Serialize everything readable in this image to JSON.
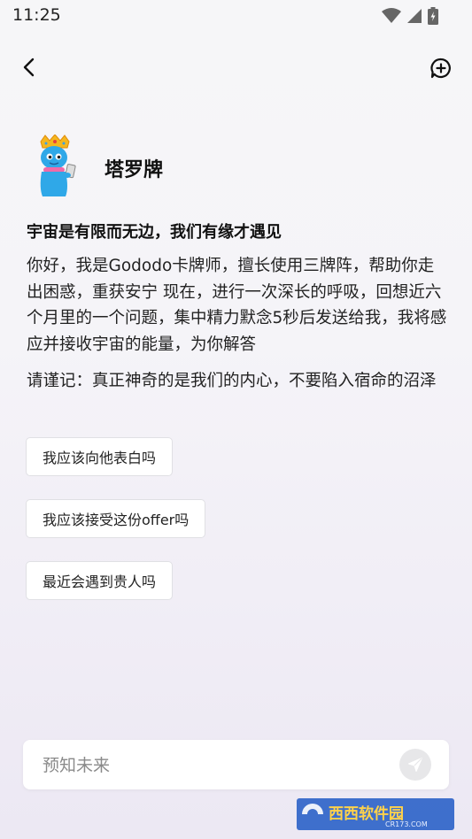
{
  "status_bar": {
    "time": "11:25",
    "icons": [
      "wifi-icon",
      "signal-icon",
      "battery-icon"
    ]
  },
  "nav": {
    "back_icon": "back-arrow-icon",
    "new_chat_icon": "new-chat-icon"
  },
  "bot": {
    "name": "塔罗牌",
    "avatar": "crowned-blue-mascot"
  },
  "message": {
    "headline": "宇宙是有限而无边，我们有缘才遇见",
    "intro": "你好，我是Gododo卡牌师，擅长使用三牌阵，帮助你走出困惑，重获安宁 现在，进行一次深长的呼吸，回想近六个月里的一个问题，集中精力默念5秒后发送给我，我将感应并接收宇宙的能量，为你解答",
    "reminder": "请谨记：真正神奇的是我们的内心，不要陷入宿命的沼泽"
  },
  "suggestions": [
    "我应该向他表白吗",
    "我应该接受这份offer吗",
    "最近会遇到贵人吗"
  ],
  "composer": {
    "placeholder": "预知未来",
    "send_icon": "send-icon"
  },
  "watermark": {
    "brand": "西西软件园",
    "domain": "CR173.COM"
  },
  "colors": {
    "text": "#111111",
    "card_border": "#e0e0e4",
    "send_bg": "#e7e7e9",
    "watermark_blue": "#2b62c8"
  }
}
